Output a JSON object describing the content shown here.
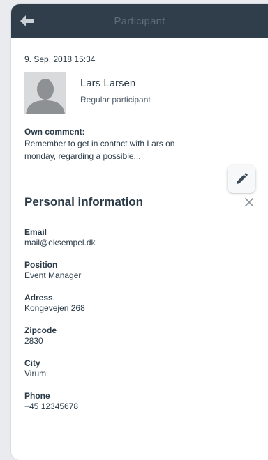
{
  "header": {
    "title": "Participant",
    "back_icon": "arrow-left-icon"
  },
  "entry": {
    "timestamp": "9. Sep. 2018 15:34"
  },
  "participant": {
    "name": "Lars Larsen",
    "role": "Regular participant",
    "avatar_icon": "user-silhouette-icon"
  },
  "comment": {
    "label": "Own comment:",
    "text_line1": "Remember to get in contact with Lars on",
    "text_line2": "monday, regarding a possible...",
    "edit_icon": "pencil-icon"
  },
  "personal": {
    "title": "Personal information",
    "close_icon": "close-icon",
    "fields": [
      {
        "label": "Email",
        "value": "mail@eksempel.dk"
      },
      {
        "label": "Position",
        "value": "Event Manager"
      },
      {
        "label": "Adress",
        "value": "Kongevejen 268"
      },
      {
        "label": "Zipcode",
        "value": "2830"
      },
      {
        "label": "City",
        "value": "Virum"
      },
      {
        "label": "Phone",
        "value": "+45 12345678"
      }
    ]
  },
  "colors": {
    "header_bg": "#2f3e4a",
    "text": "#2a3a47",
    "avatar_bg": "#d8dadc"
  }
}
